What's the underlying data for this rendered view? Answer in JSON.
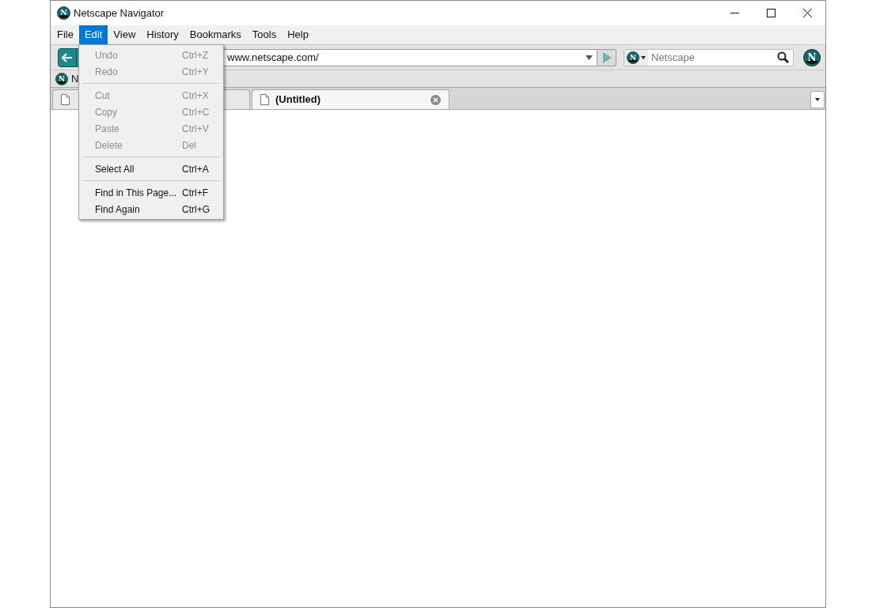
{
  "window": {
    "logo": "N",
    "title": "Netscape Navigator"
  },
  "menu_bar": [
    {
      "label": "File",
      "selected": false
    },
    {
      "label": "Edit",
      "selected": true
    },
    {
      "label": "View",
      "selected": false
    },
    {
      "label": "History",
      "selected": false
    },
    {
      "label": "Bookmarks",
      "selected": false
    },
    {
      "label": "Tools",
      "selected": false
    },
    {
      "label": "Help",
      "selected": false
    }
  ],
  "edit_menu": [
    {
      "kind": "item",
      "label": "Undo",
      "shortcut": "Ctrl+Z",
      "disabled": true
    },
    {
      "kind": "item",
      "label": "Redo",
      "shortcut": "Ctrl+Y",
      "disabled": true
    },
    {
      "kind": "separator"
    },
    {
      "kind": "item",
      "label": "Cut",
      "shortcut": "Ctrl+X",
      "disabled": true
    },
    {
      "kind": "item",
      "label": "Copy",
      "shortcut": "Ctrl+C",
      "disabled": true
    },
    {
      "kind": "item",
      "label": "Paste",
      "shortcut": "Ctrl+V",
      "disabled": true
    },
    {
      "kind": "item",
      "label": "Delete",
      "shortcut": "Del",
      "disabled": true
    },
    {
      "kind": "separator"
    },
    {
      "kind": "item",
      "label": "Select All",
      "shortcut": "Ctrl+A",
      "disabled": false
    },
    {
      "kind": "separator"
    },
    {
      "kind": "item",
      "label": "Find in This Page...",
      "shortcut": "Ctrl+F",
      "disabled": false
    },
    {
      "kind": "item",
      "label": "Find Again",
      "shortcut": "Ctrl+G",
      "disabled": false
    }
  ],
  "address_bar": {
    "value": "www.netscape.com/"
  },
  "search": {
    "engine_logo": "N",
    "placeholder": "Netscape"
  },
  "throbber": {
    "logo": "N"
  },
  "bookmarks_toolbar": [
    {
      "logo": "N",
      "label": "N"
    }
  ],
  "tabs": [
    {
      "selected": false
    },
    {
      "label": "(Untitled)",
      "selected": true
    }
  ]
}
